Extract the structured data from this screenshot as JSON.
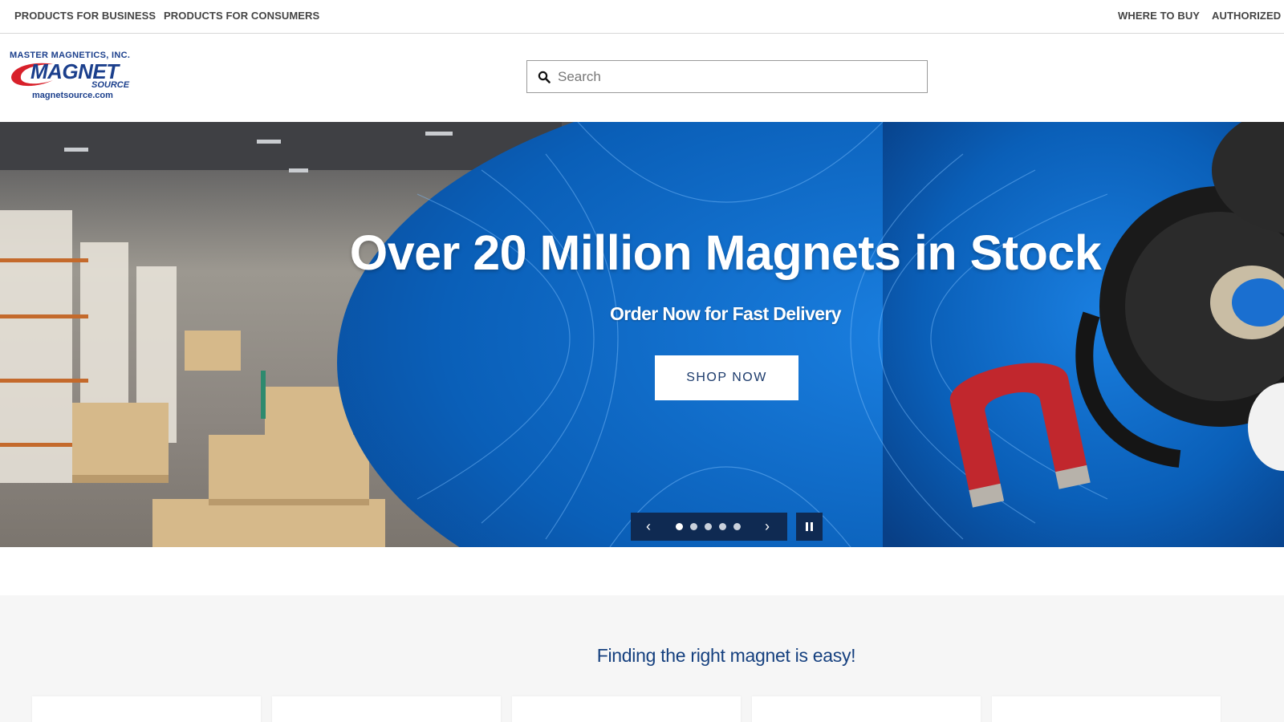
{
  "topbar": {
    "left_links": [
      "PRODUCTS FOR BUSINESS",
      "PRODUCTS FOR CONSUMERS"
    ],
    "right_links": [
      "WHERE TO BUY",
      "AUTHORIZED D"
    ]
  },
  "logo": {
    "company": "MASTER MAGNETICS, INC.",
    "brand": "MAGNET",
    "brand_sub": "SOURCE",
    "domain": "magnetsource.com"
  },
  "search": {
    "placeholder": "Search",
    "icon": "search-icon"
  },
  "hero": {
    "title": "Over 20 Million Magnets in Stock",
    "subtitle": "Order Now for Fast Delivery",
    "cta_label": "SHOP NOW",
    "slides_count": 5,
    "active_slide": 1,
    "prev_icon": "chevron-left-icon",
    "next_icon": "chevron-right-icon",
    "pause_icon": "pause-icon"
  },
  "finder": {
    "heading": "Finding the right magnet is easy!",
    "cards_count": 5
  },
  "colors": {
    "brand_navy": "#1b3f8c",
    "hero_blue": "#0a62c0",
    "carousel_bg": "#0f2a52",
    "heading_blue": "#15407f",
    "section_bg": "#f6f6f6"
  }
}
